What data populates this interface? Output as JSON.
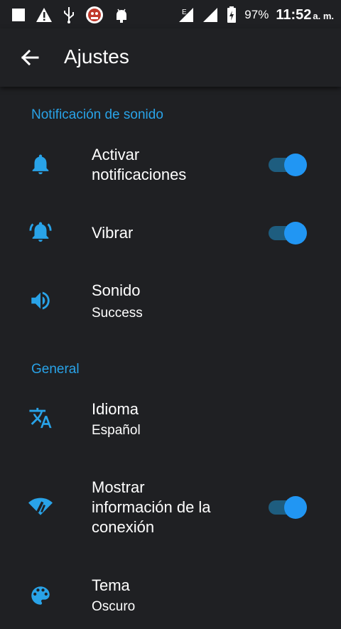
{
  "status_bar": {
    "battery": "97%",
    "time": "11:52",
    "ampm": "a. m.",
    "signal_label": "E"
  },
  "toolbar": {
    "title": "Ajustes"
  },
  "sections": {
    "sound": "Notificación de sonido",
    "general": "General"
  },
  "items": {
    "notifications": {
      "label": "Activar\nnotificaciones",
      "on": true,
      "icon": "bell-icon"
    },
    "vibrate": {
      "label": "Vibrar",
      "on": true,
      "icon": "vibrate-bell-icon"
    },
    "sound": {
      "label": "Sonido",
      "value": "Success",
      "icon": "speaker-icon"
    },
    "language": {
      "label": "Idioma",
      "value": "Español",
      "icon": "translate-icon"
    },
    "connection": {
      "label": "Mostrar\ninformación de la\nconexión",
      "on": true,
      "icon": "wifi-signal-icon"
    },
    "theme": {
      "label": "Tema",
      "value": "Oscuro",
      "icon": "palette-icon"
    }
  },
  "colors": {
    "accent": "#29a3e8",
    "background": "#1f2023",
    "toggle_track": "#1e5d7f",
    "toggle_thumb": "#2196f3"
  }
}
